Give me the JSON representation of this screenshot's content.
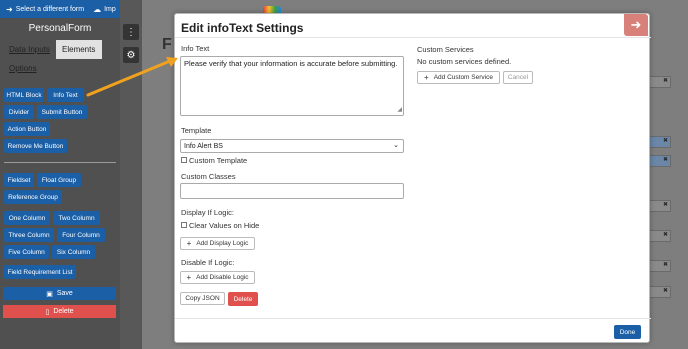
{
  "topbar": {
    "select_form_label": "Select a different form",
    "import_label": "Imp"
  },
  "form": {
    "title": "PersonalForm"
  },
  "tabs": {
    "data_inputs": "Data Inputs",
    "elements": "Elements",
    "options": "Options"
  },
  "elements": {
    "html_block": "HTML Block",
    "info_text": "Info Text",
    "divider": "Divider",
    "submit_button": "Submit Button",
    "action_button": "Action Button",
    "remove_me_button": "Remove Me Button",
    "fieldset": "Fieldset",
    "float_group": "Float Group",
    "reference_group": "Reference Group",
    "one_column": "One Column",
    "two_column": "Two Column",
    "three_column": "Three Column",
    "four_column": "Four Column",
    "five_column": "Five Column",
    "six_column": "Six Column",
    "field_requirement_list": "Field Requirement List"
  },
  "actions": {
    "save_label": "Save",
    "delete_label": "Delete"
  },
  "canvas": {
    "title_glimpse": "F"
  },
  "modal": {
    "title": "Edit infoText Settings",
    "info_text_label": "Info Text",
    "info_text_value": "Please verify that your information is accurate before submitting.",
    "template_label": "Template",
    "template_value": "Info Alert BS",
    "custom_template_label": "Custom Template",
    "custom_classes_label": "Custom Classes",
    "custom_classes_value": "",
    "display_if_label": "Display If Logic:",
    "clear_values_label": "Clear Values on Hide",
    "add_display_logic_label": "Add Display Logic",
    "disable_if_label": "Disable If Logic:",
    "add_disable_logic_label": "Add Disable Logic",
    "copy_json_label": "Copy JSON",
    "delete_label": "Delete",
    "custom_services_label": "Custom Services",
    "no_services_text": "No custom services defined.",
    "add_custom_service_label": "Add Custom Service",
    "cancel_label": "Cancel",
    "done_label": "Done"
  },
  "colors": {
    "primary": "#1b5fa6",
    "danger": "#e0514d",
    "arrow": "#f0a21f",
    "close": "#d8807a"
  },
  "icons": {
    "back": "arrow-left-icon",
    "cloud": "cloud-upload-icon",
    "more": "ellipsis-vertical-icon",
    "settings": "gear-icon",
    "save": "save-icon",
    "trash": "trash-icon",
    "close": "arrow-right-icon",
    "plus": "plus-icon"
  }
}
